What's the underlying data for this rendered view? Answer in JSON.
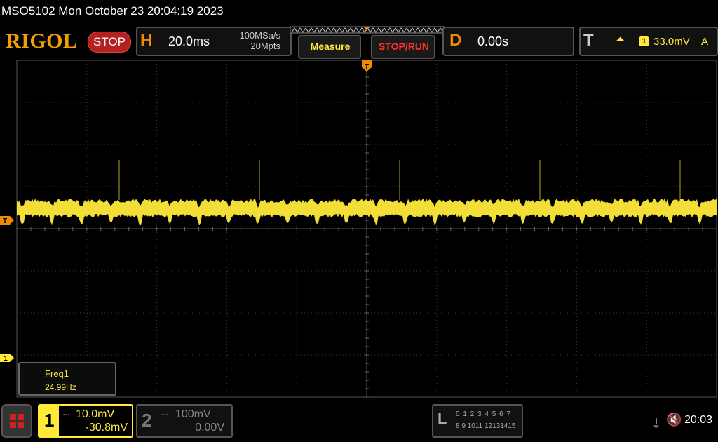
{
  "title": "MSO5102  Mon October 23 20:04:19 2023",
  "brand": "RIGOL",
  "status": "STOP",
  "horizontal": {
    "letter": "H",
    "scale": "20.0ms",
    "sample_rate": "100MSa/s",
    "memory_depth": "20Mpts"
  },
  "buttons": {
    "measure": "Measure",
    "stop_run": "STOP/RUN"
  },
  "delay": {
    "letter": "D",
    "value": "0.00s"
  },
  "trigger": {
    "letter": "T",
    "edge_icon": "rising-edge-icon",
    "edge_glyph": "⏶",
    "source": "1",
    "level": "33.0mV",
    "mode": "A"
  },
  "markers": {
    "trigger_top": "T",
    "trigger_left": "T",
    "channel1_left": "1"
  },
  "measurement": {
    "label": "Freq1",
    "value": "24.99Hz"
  },
  "channel1": {
    "number": "1",
    "coupling_glyph": "⎓",
    "scale": "10.0mV",
    "offset": "-30.8mV",
    "color": "#ffea3a"
  },
  "channel2": {
    "number": "2",
    "coupling_glyph": "⎓",
    "scale": "100mV",
    "offset": "0.00V",
    "color": "#888888"
  },
  "logic": {
    "letter": "L",
    "row1": "0 1 2 3  4 5 6 7",
    "row2": "8 9 1011 12131415"
  },
  "statusbar": {
    "usb_glyph": "⏚",
    "speaker_glyph": "🔇",
    "time": "20:03"
  },
  "colors": {
    "accent": "#f08a00",
    "trace": "#ffea3a",
    "grid": "#3a3a3a",
    "stop": "#b52020"
  }
}
